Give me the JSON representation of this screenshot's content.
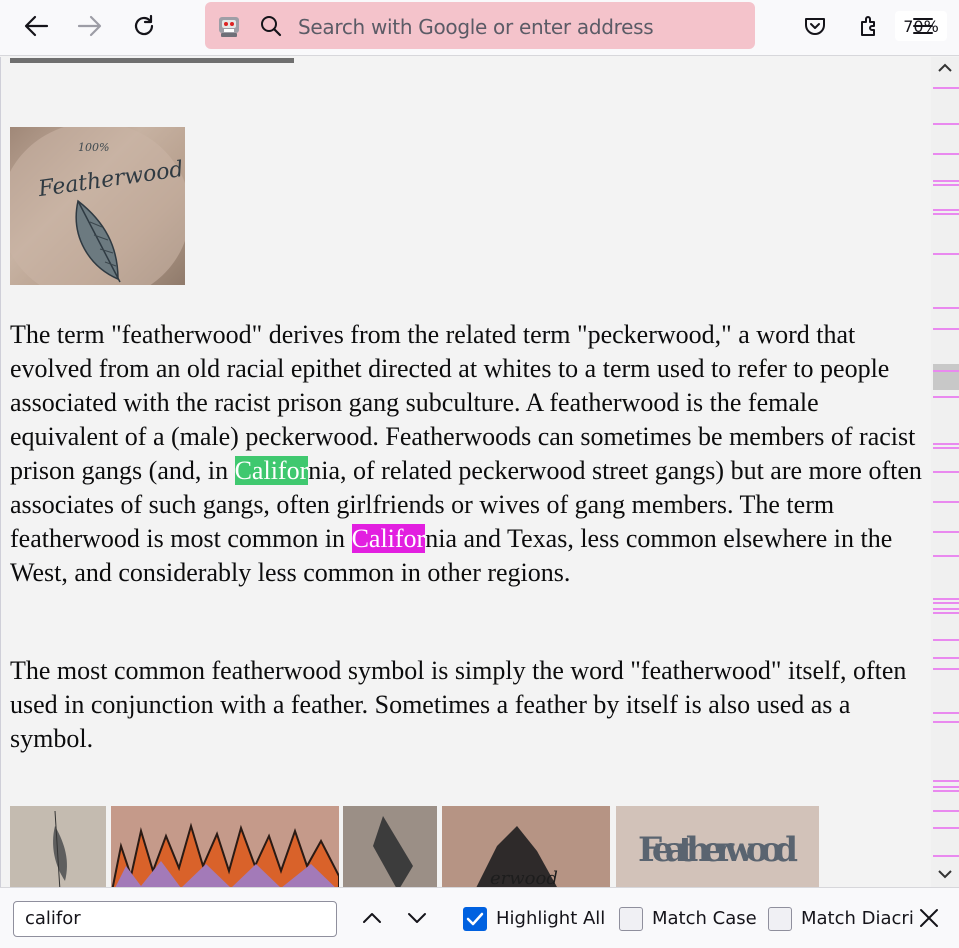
{
  "toolbar": {
    "url_placeholder": "Search with Google or enter address",
    "zoom": "70%"
  },
  "article": {
    "paragraph1": [
      {
        "t": "The term \"featherwood\" derives from the related term \"peckerwood,\" a word that evolved from an old racial epithet directed at whites to a term used to refer to people associated with the racist prison gang subculture. A featherwood is the female equivalent of a (male) peckerwood. Featherwoods can sometimes be members of racist prison gangs (and, in "
      },
      {
        "t": "Califor",
        "hl": "current"
      },
      {
        "t": "nia, of related peckerwood street gangs) but are more often associates of such gangs, often girlfriends or wives of gang members. The term featherwood is most common in "
      },
      {
        "t": "Califor",
        "hl": "other"
      },
      {
        "t": "nia and Texas, less common elsewhere in the West, and considerably less common in other regions."
      }
    ],
    "paragraph2": "The most common featherwood symbol is simply the word \"featherwood\" itself, often used in conjunction with a feather. Sometimes a feather by itself is also used as a symbol.",
    "photo_text": "100% Featherwood",
    "thumbnail_text": "Featherwood"
  },
  "findbar": {
    "query": "califor",
    "highlight_all": "Highlight All",
    "highlight_all_checked": true,
    "match_case": "Match Case",
    "match_case_checked": false,
    "match_diacritics": "Match Diacri"
  },
  "colors": {
    "current_match": "#3fc86f",
    "other_match": "#e21fe0",
    "urlbar": "#f4c3cb"
  }
}
